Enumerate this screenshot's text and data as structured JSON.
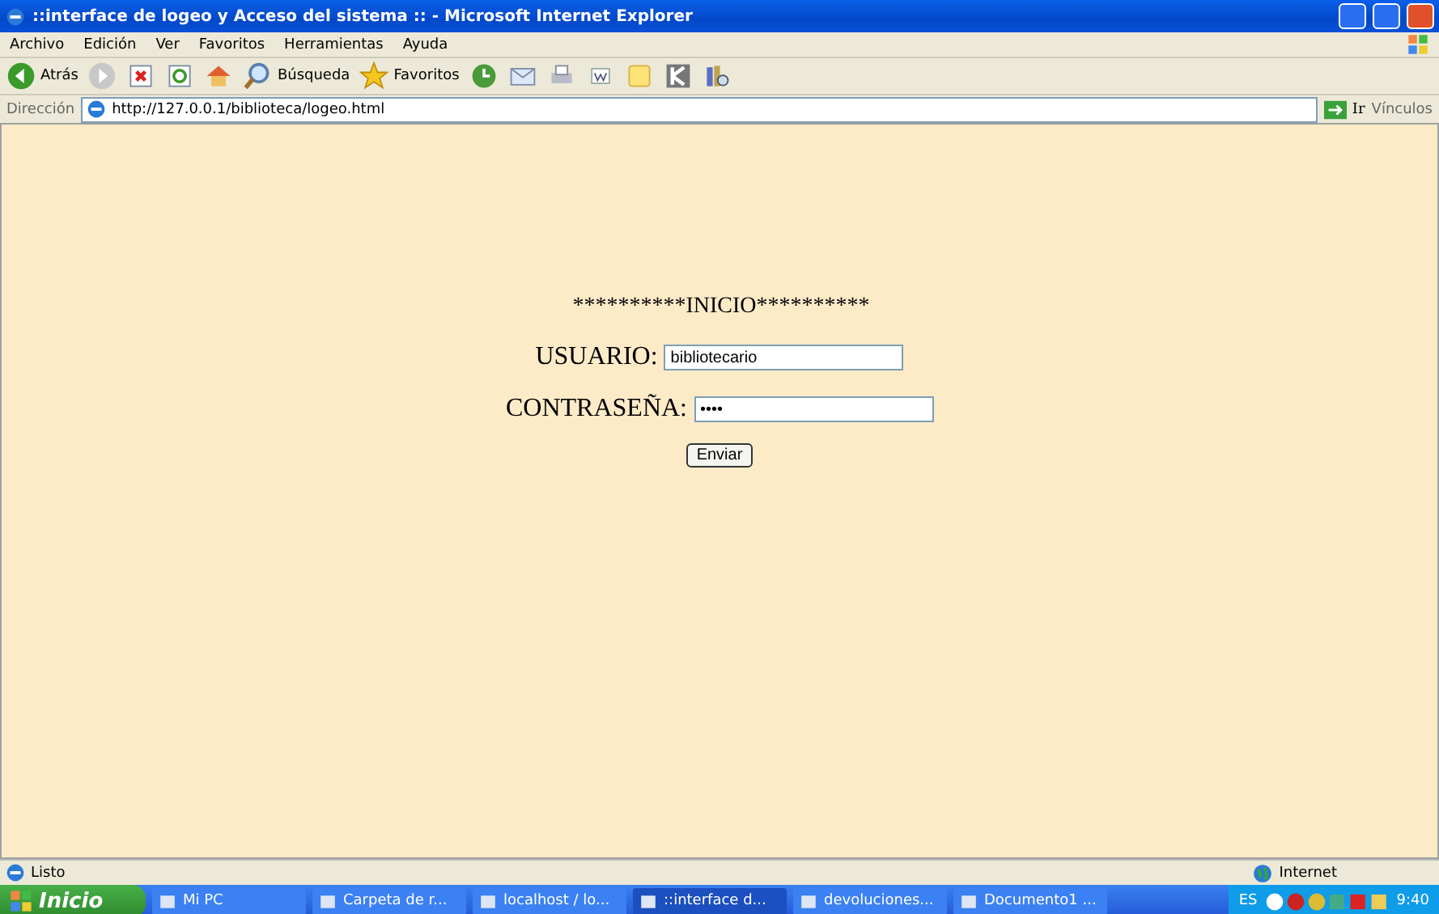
{
  "window": {
    "title": "::interface de logeo y Acceso del sistema :: - Microsoft Internet Explorer"
  },
  "menu": [
    "Archivo",
    "Edición",
    "Ver",
    "Favoritos",
    "Herramientas",
    "Ayuda"
  ],
  "toolbar": [
    {
      "kind": "back",
      "label": "Atrás"
    },
    {
      "kind": "forward"
    },
    {
      "kind": "stop"
    },
    {
      "kind": "refresh"
    },
    {
      "kind": "home"
    },
    {
      "kind": "search",
      "label": "Búsqueda"
    },
    {
      "kind": "favorites",
      "label": "Favoritos"
    },
    {
      "kind": "history"
    },
    {
      "kind": "mail"
    },
    {
      "kind": "print"
    },
    {
      "kind": "word"
    },
    {
      "kind": "note"
    },
    {
      "kind": "kapp"
    },
    {
      "kind": "books"
    }
  ],
  "address": {
    "label": "Dirección",
    "url": "http://127.0.0.1/biblioteca/logeo.html",
    "go": "Ir",
    "links": "Vínculos"
  },
  "form": {
    "heading": "**********INICIO**********",
    "user_label": "USUARIO:",
    "user_value": "bibliotecario",
    "password_label": "CONTRASEÑA:",
    "password_value": "••••",
    "submit": "Enviar"
  },
  "status_bar": {
    "text": "Listo",
    "zone": "Internet"
  },
  "taskbar": {
    "start": "Inicio",
    "items": [
      {
        "label": "Mi PC",
        "selected": false
      },
      {
        "label": "Carpeta de r...",
        "selected": false
      },
      {
        "label": "localhost / lo...",
        "selected": false
      },
      {
        "label": "::interface d...",
        "selected": true
      },
      {
        "label": "devoluciones...",
        "selected": false
      },
      {
        "label": "Documento1 ...",
        "selected": false
      }
    ],
    "language": "ES",
    "time": "9:40"
  }
}
